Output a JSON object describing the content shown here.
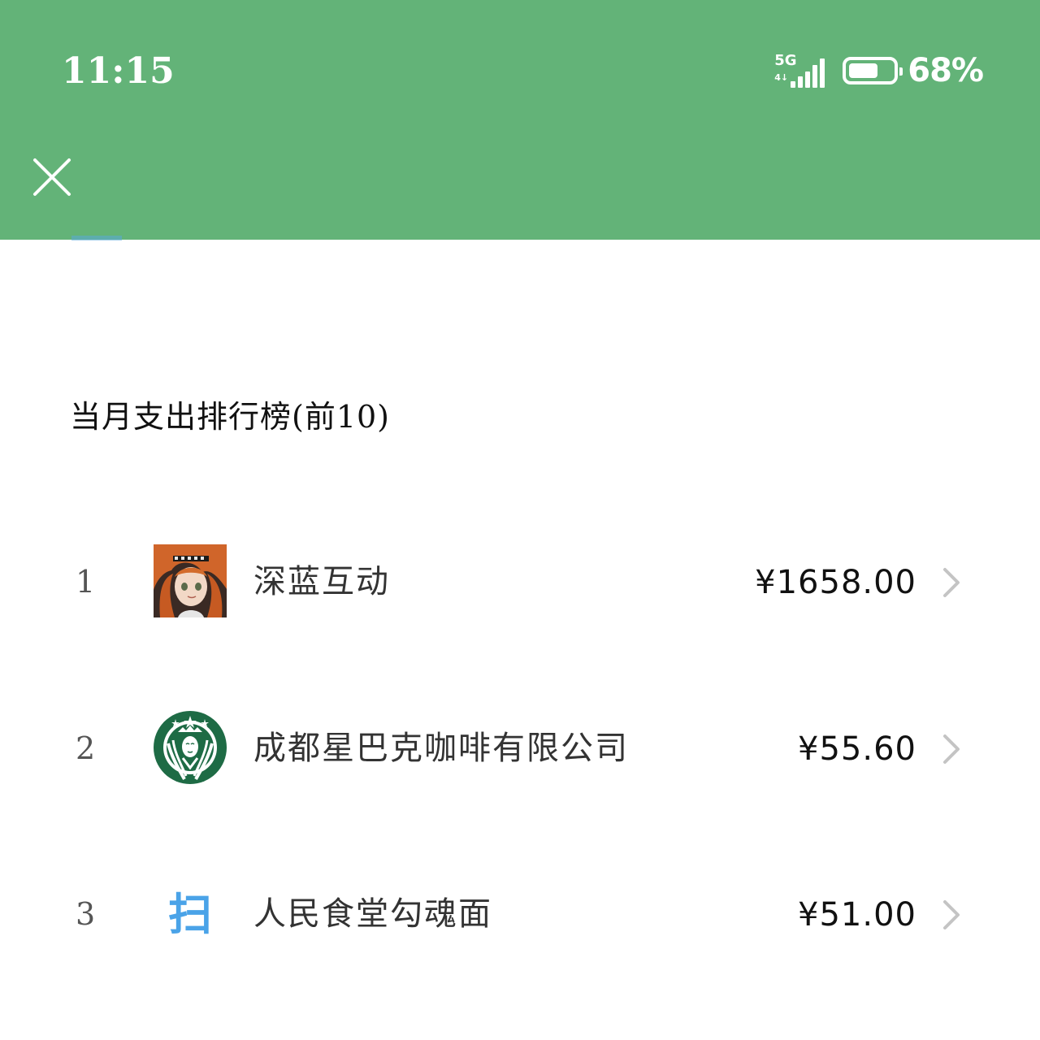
{
  "status_bar": {
    "time": "11:15",
    "network": "5G",
    "network_sub": "4↓",
    "signal_bars": 5,
    "battery_percent": "68%",
    "battery_level": 0.68
  },
  "header": {
    "close_icon": "close-icon",
    "background_color": "#63b378"
  },
  "section": {
    "title": "当月支出排行榜(前10)"
  },
  "ranking": [
    {
      "rank": "1",
      "merchant": "深蓝互动",
      "amount": "¥1658.00",
      "avatar": "anime-avatar"
    },
    {
      "rank": "2",
      "merchant": "成都星巴克咖啡有限公司",
      "amount": "¥55.60",
      "avatar": "starbucks-logo"
    },
    {
      "rank": "3",
      "merchant": "人民食堂勾魂面",
      "amount": "¥51.00",
      "avatar": "scan-icon"
    }
  ],
  "scan_glyph": "扫"
}
